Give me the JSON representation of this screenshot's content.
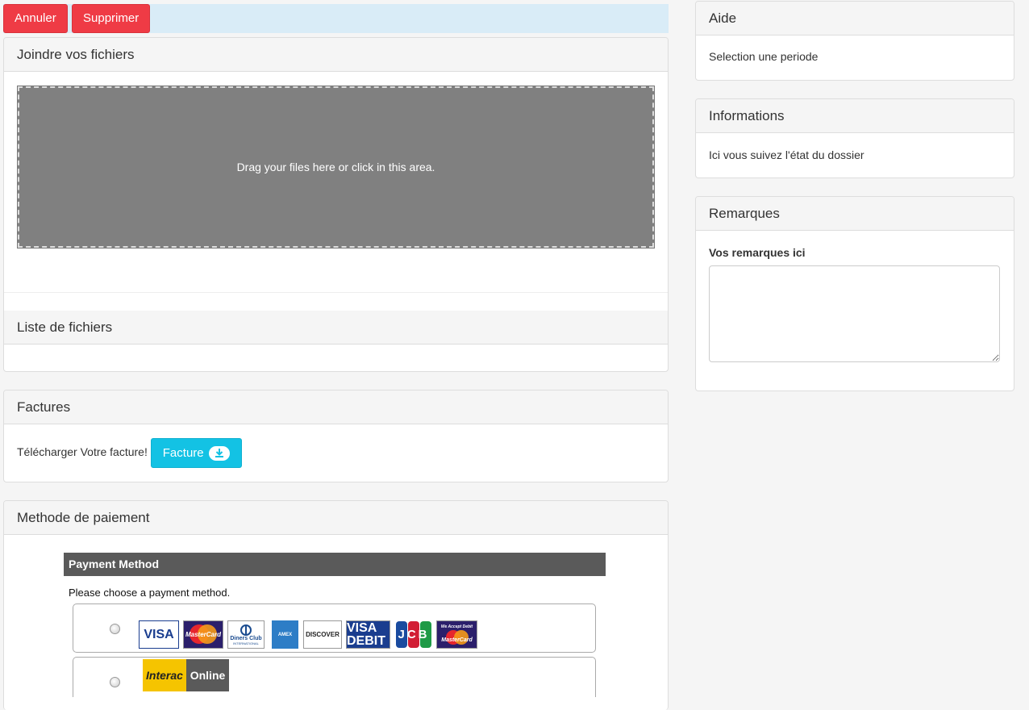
{
  "toolbar": {
    "cancel_label": "Annuler",
    "delete_label": "Supprimer"
  },
  "attach": {
    "title": "Joindre vos fichiers",
    "dropzone_text": "Drag your files here or click in this area.",
    "list_title": "Liste de fichiers"
  },
  "invoices": {
    "title": "Factures",
    "text": "Télécharger Votre facture!",
    "button_label": "Facture",
    "button_icon": "download-icon"
  },
  "payment": {
    "title": "Methode de paiement",
    "frame_title": "Payment Method",
    "prompt": "Please choose a payment method.",
    "cards": [
      "VISA",
      "MasterCard",
      "Diners Club",
      "AMEX",
      "DISCOVER",
      "VISA DEBIT",
      "JCB",
      "MasterCard"
    ],
    "diners_sub": "INTERNATIONAL",
    "mc_accept": "We Accept Debit",
    "interac_label": "Interac",
    "interac_online": "Online"
  },
  "help": {
    "title": "Aide",
    "text": "Selection une periode"
  },
  "info": {
    "title": "Informations",
    "text": "Ici vous suivez l'état du dossier"
  },
  "remarks": {
    "title": "Remarques",
    "label": "Vos remarques ici"
  },
  "colors": {
    "danger": "#ef3b45",
    "info": "#13c2e4",
    "toolbar_bg": "#d9ecf7",
    "dropzone_bg": "#808080"
  }
}
